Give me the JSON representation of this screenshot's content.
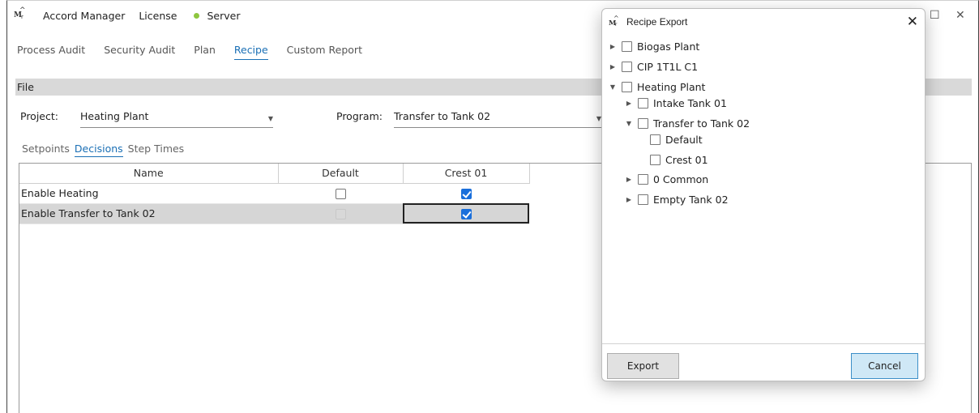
{
  "titlebar": {
    "logo": "M",
    "app_title": "Accord Manager",
    "license": "License",
    "server_label": "Server",
    "server_status_color": "#8ec63f"
  },
  "main_tabs": [
    "Process Audit",
    "Security Audit",
    "Plan",
    "Recipe",
    "Custom Report"
  ],
  "active_main_tab": "Recipe",
  "file_bar": "File",
  "project": {
    "label": "Project:",
    "value": "Heating Plant"
  },
  "program": {
    "label": "Program:",
    "value": "Transfer to Tank 02"
  },
  "sub_tabs": [
    "Setpoints",
    "Decisions",
    "Step Times"
  ],
  "active_sub_tab": "Decisions",
  "grid": {
    "columns": [
      "Name",
      "Default",
      "Crest 01"
    ],
    "rows": [
      {
        "name": "Enable Heating",
        "default": false,
        "crest01": true,
        "selected": false
      },
      {
        "name": "Enable Transfer to Tank 02",
        "default": false,
        "crest01": true,
        "selected": true
      }
    ]
  },
  "dialog": {
    "title": "Recipe Export",
    "tree": [
      {
        "label": "Biogas Plant",
        "level": 0,
        "expander": "collapsed"
      },
      {
        "label": "CIP 1T1L C1",
        "level": 0,
        "expander": "collapsed"
      },
      {
        "label": "Heating Plant",
        "level": 0,
        "expander": "expanded"
      },
      {
        "label": "Intake Tank 01",
        "level": 1,
        "expander": "collapsed"
      },
      {
        "label": "Transfer to Tank 02",
        "level": 1,
        "expander": "expanded"
      },
      {
        "label": "Default",
        "level": 2,
        "expander": "none"
      },
      {
        "label": "Crest 01",
        "level": 2,
        "expander": "none"
      },
      {
        "label": "0 Common",
        "level": 1,
        "expander": "collapsed"
      },
      {
        "label": "Empty Tank 02",
        "level": 1,
        "expander": "collapsed"
      }
    ],
    "export_label": "Export",
    "cancel_label": "Cancel"
  },
  "icons": {
    "close": "close-icon",
    "maximize": "maximize-icon",
    "expand": "triangle-down-icon",
    "collapse": "triangle-right-icon"
  }
}
